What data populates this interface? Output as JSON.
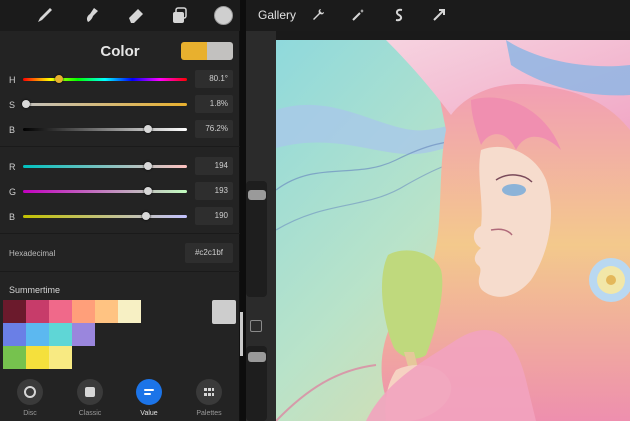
{
  "toolbar": {
    "tools": [
      "brush-icon",
      "smudge-icon",
      "eraser-icon",
      "layers-icon",
      "color-well-icon"
    ]
  },
  "color_panel": {
    "title": "Color",
    "current_color": "#e8b02e",
    "previous_color": "#c2c1bf",
    "hsb": [
      {
        "label": "H",
        "value": "80.1°",
        "fraction": 0.22
      },
      {
        "label": "S",
        "value": "1.8%",
        "fraction": 0.02
      },
      {
        "label": "B",
        "value": "76.2%",
        "fraction": 0.76
      }
    ],
    "rgb": [
      {
        "label": "R",
        "value": "194",
        "fraction": 0.76
      },
      {
        "label": "G",
        "value": "193",
        "fraction": 0.76
      },
      {
        "label": "B",
        "value": "190",
        "fraction": 0.75
      }
    ],
    "hex_label": "Hexadecimal",
    "hex_value": "#c2c1bf",
    "palette": {
      "name": "Summertime",
      "rows": [
        [
          "#6b1a2c",
          "#c73c6a",
          "#f0698a",
          "#ff9f7a",
          "#ffc382",
          "#f7f0c4"
        ],
        [
          "#6a7fe6",
          "#5cb8f0",
          "#5fd6d6",
          "#9a86dd"
        ],
        [
          "#76c24e",
          "#f5e03c",
          "#f8ea82"
        ]
      ]
    },
    "tabs": [
      {
        "label": "Disc",
        "icon": "disc-icon",
        "active": false
      },
      {
        "label": "Classic",
        "icon": "classic-icon",
        "active": false
      },
      {
        "label": "Value",
        "icon": "value-icon",
        "active": true
      },
      {
        "label": "Palettes",
        "icon": "palettes-icon",
        "active": false
      }
    ]
  },
  "header": {
    "gallery_label": "Gallery",
    "tools": [
      "wrench-icon",
      "magic-wand-icon",
      "selection-icon",
      "transform-icon"
    ]
  }
}
